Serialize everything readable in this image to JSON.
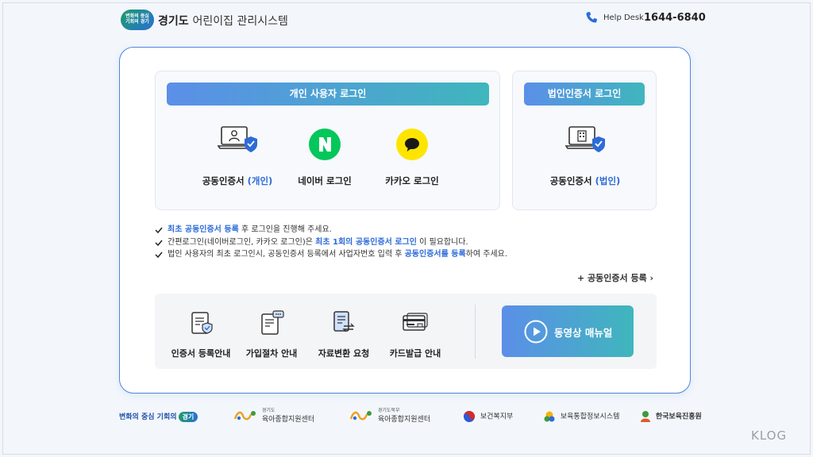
{
  "header": {
    "logo_lines": [
      "변화의 중심",
      "기회의 경기"
    ],
    "title_bold": "경기도",
    "title_rest": "어린이집 관리시스템",
    "help_label": "Help Desk",
    "help_number": "1644-6840"
  },
  "personal_login": {
    "title": "개인 사용자 로그인",
    "options": [
      {
        "label_pre": "공동인증서 ",
        "label_hl": "(개인)",
        "icon": "laptop-user-shield-icon"
      },
      {
        "label_pre": "네이버 로그인",
        "label_hl": "",
        "icon": "naver-icon",
        "glyph": "N",
        "color": "#03c75a"
      },
      {
        "label_pre": "카카오 로그인",
        "label_hl": "",
        "icon": "kakao-icon",
        "color": "#fee500"
      }
    ]
  },
  "corp_login": {
    "title": "법인인증서 로그인",
    "option": {
      "label_pre": "공동인증서 ",
      "label_hl": "(법인)",
      "icon": "laptop-building-shield-icon"
    }
  },
  "notes": [
    {
      "parts": [
        {
          "t": "최초 공동인증서 등록",
          "em": true
        },
        {
          "t": " 후 로그인을 진행해 주세요.",
          "em": false
        }
      ]
    },
    {
      "parts": [
        {
          "t": "간편로그인(네이버로그인, 카카오 로그인)은 ",
          "em": false
        },
        {
          "t": "최초 1회의 공동인증서 로그인",
          "em": true
        },
        {
          "t": " 이 필요합니다.",
          "em": false
        }
      ]
    },
    {
      "parts": [
        {
          "t": "법인 사용자의 최초 로그인시, 공동인증서 등록에서 사업자번호 입력 후 ",
          "em": false
        },
        {
          "t": "공동인증서를 등록",
          "em": true
        },
        {
          "t": "하여 주세요.",
          "em": false
        }
      ]
    }
  ],
  "register_link": "+ 공동인증서 등록  ›",
  "guides": [
    {
      "label": "인증서 등록안내",
      "icon": "certificate-doc-icon"
    },
    {
      "label": "가입절차 안내",
      "icon": "procedure-doc-icon"
    },
    {
      "label": "자료변환 요청",
      "icon": "data-convert-icon"
    },
    {
      "label": "카드발급 안내",
      "icon": "card-icon"
    }
  ],
  "video_button": {
    "label": "동영상 매뉴얼",
    "icon": "play-icon"
  },
  "footer": {
    "gg_text": "변화의 중심 기회의",
    "gg_pill": "경기",
    "centers": [
      {
        "small": "경기도",
        "name": "육아종합지원센터"
      },
      {
        "small": "경기도북부",
        "name": "육아종합지원센터"
      }
    ],
    "mohw": "보건복지부",
    "childcare_info": "보육통합정보시스템",
    "kcpi": "한국보육진흥원"
  },
  "watermark": "KLOG",
  "colors": {
    "accent": "#2d6bd8",
    "gradient_start": "#5b8fe8",
    "gradient_end": "#3fb6bd",
    "naver": "#03c75a",
    "kakao": "#fee500"
  }
}
